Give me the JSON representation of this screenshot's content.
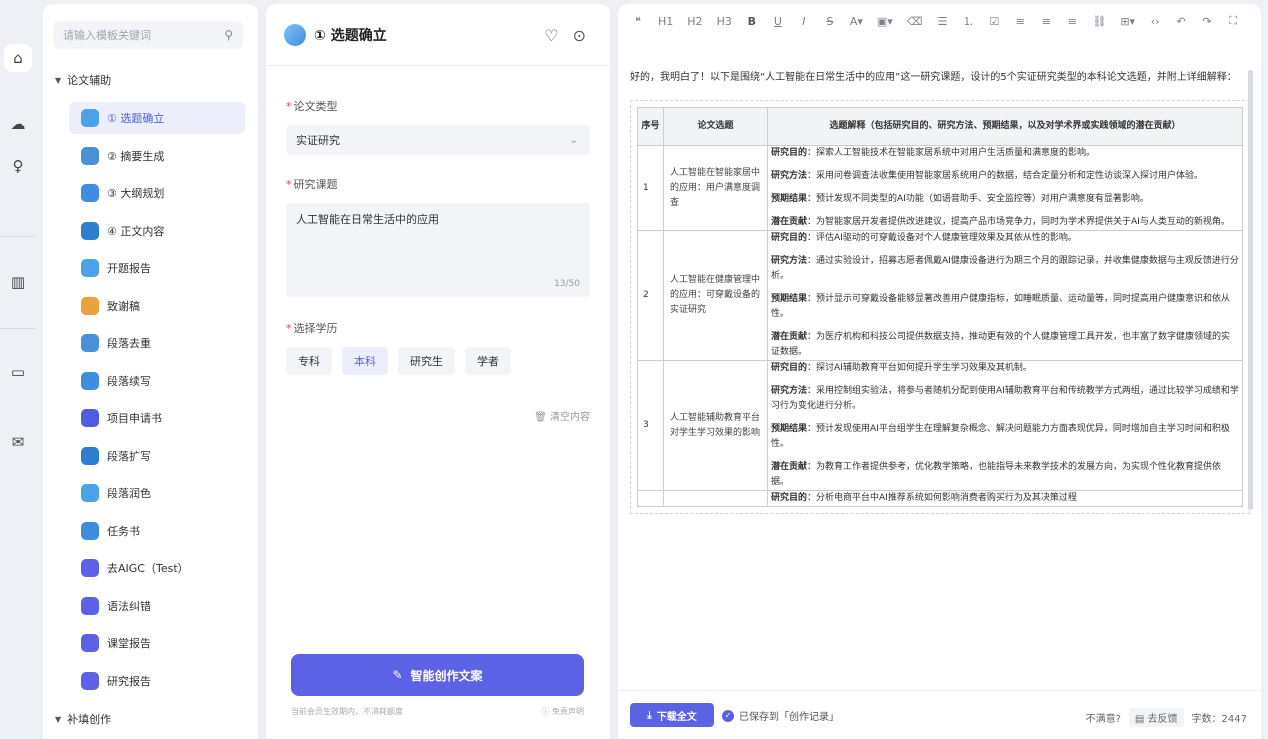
{
  "rail": {
    "items": [
      {
        "icon": "home-icon",
        "glyph": "⌂"
      },
      {
        "icon": "cloud-icon",
        "glyph": "☁"
      },
      {
        "icon": "lightbulb-icon",
        "glyph": "♀"
      },
      {
        "icon": "book-icon",
        "glyph": "▥"
      },
      {
        "icon": "chat-icon",
        "glyph": "▭"
      },
      {
        "icon": "mail-icon",
        "glyph": "✉"
      }
    ]
  },
  "sidebar": {
    "search_placeholder": "请输入模板关键词",
    "group1": "论文辅助",
    "group2": "补填创作",
    "items": [
      {
        "label": "① 选题确立",
        "color": "#4aa3e8"
      },
      {
        "label": "② 摘要生成",
        "color": "#4a90d9"
      },
      {
        "label": "③ 大纲规划",
        "color": "#3d8de0"
      },
      {
        "label": "④ 正文内容",
        "color": "#2d7dd2"
      },
      {
        "label": "开题报告",
        "color": "#4aa3e8"
      },
      {
        "label": "致谢稿",
        "color": "#e8a33d"
      },
      {
        "label": "段落去重",
        "color": "#4a90d9"
      },
      {
        "label": "段落续写",
        "color": "#3d8de0"
      },
      {
        "label": "项目申请书",
        "color": "#4f5de0"
      },
      {
        "label": "段落扩写",
        "color": "#2d7dd2"
      },
      {
        "label": "段落润色",
        "color": "#4aa3e8"
      },
      {
        "label": "任务书",
        "color": "#3d8de0"
      },
      {
        "label": "去AIGC（Test）",
        "color": "#5b62e6"
      },
      {
        "label": "语法纠错",
        "color": "#5b62e6"
      },
      {
        "label": "课堂报告",
        "color": "#5b62e6"
      },
      {
        "label": "研究报告",
        "color": "#5b62e6"
      }
    ]
  },
  "form": {
    "title": "① 选题确立",
    "type_label": "论文类型",
    "type_value": "实证研究",
    "topic_label": "研究课题",
    "topic_value": "人工智能在日常生活中的应用",
    "topic_count": "13/50",
    "degree_label": "选择学历",
    "degrees": [
      "专科",
      "本科",
      "研究生",
      "学者"
    ],
    "selected_degree": "本科",
    "clear_label": "清空内容",
    "generate_label": "智能创作文案",
    "foot_left": "当前会员生效期内，不消耗额度",
    "foot_right": "免责声明"
  },
  "editor": {
    "toolbar": [
      "❝",
      "H1",
      "H2",
      "H3",
      "B",
      "U",
      "I",
      "S",
      "A▾",
      "▣▾",
      "⌫",
      "☰",
      "⒈",
      "☑",
      "≡",
      "≡",
      "≡",
      "⛓",
      "⊞▾",
      "‹›",
      "↶",
      "↷",
      "⛶"
    ],
    "intro": "好的，我明白了！以下是围绕“人工智能在日常生活中的应用”这一研究课题，设计的5个实证研究类型的本科论文选题，并附上详细解释：",
    "headers": [
      "序号",
      "论文选题",
      "选题解释（包括研究目的、研究方法、预期结果，以及对学术界或实践领域的潜在贡献）"
    ],
    "rows": [
      {
        "no": "1",
        "title": "人工智能在智能家居中的应用：用户满意度调查",
        "parts": [
          {
            "k": "研究目的",
            "v": "：探索人工智能技术在智能家居系统中对用户生活质量和满意度的影响。"
          },
          {
            "k": "研究方法",
            "v": "：采用问卷调查法收集使用智能家居系统用户的数据，结合定量分析和定性访谈深入探讨用户体验。"
          },
          {
            "k": "预期结果",
            "v": "：预计发现不同类型的AI功能（如语音助手、安全监控等）对用户满意度有显著影响。"
          },
          {
            "k": "潜在贡献",
            "v": "：为智能家居开发者提供改进建议，提高产品市场竞争力，同时为学术界提供关于AI与人类互动的新视角。"
          }
        ]
      },
      {
        "no": "2",
        "title": "人工智能在健康管理中的应用：可穿戴设备的实证研究",
        "parts": [
          {
            "k": "研究目的",
            "v": "：评估AI驱动的可穿戴设备对个人健康管理效果及其依从性的影响。"
          },
          {
            "k": "研究方法",
            "v": "：通过实验设计，招募志愿者佩戴AI健康设备进行为期三个月的跟踪记录，并收集健康数据与主观反馈进行分析。"
          },
          {
            "k": "预期结果",
            "v": "：预计显示可穿戴设备能够显著改善用户健康指标，如睡眠质量、运动量等，同时提高用户健康意识和依从性。"
          },
          {
            "k": "潜在贡献",
            "v": "：为医疗机构和科技公司提供数据支持，推动更有效的个人健康管理工具开发，也丰富了数字健康领域的实证数据。"
          }
        ]
      },
      {
        "no": "3",
        "title": "人工智能辅助教育平台对学生学习效果的影响",
        "parts": [
          {
            "k": "研究目的",
            "v": "：探讨AI辅助教育平台如何提升学生学习效果及其机制。"
          },
          {
            "k": "研究方法",
            "v": "：采用控制组实验法，将参与者随机分配到使用AI辅助教育平台和传统教学方式两组，通过比较学习成绩和学习行为变化进行分析。"
          },
          {
            "k": "预期结果",
            "v": "：预计发现使用AI平台组学生在理解复杂概念、解决问题能力方面表现优异，同时增加自主学习时间和积极性。"
          },
          {
            "k": "潜在贡献",
            "v": "：为教育工作者提供参考，优化教学策略，也能指导未来教学技术的发展方向，为实现个性化教育提供依据。"
          }
        ]
      },
      {
        "no": "",
        "title": "",
        "parts": [
          {
            "k": "研究目的",
            "v": "：分析电商平台中AI推荐系统如何影响消费者购买行为及其决策过程"
          }
        ]
      }
    ],
    "download_label": "下载全文",
    "saved_label": "已保存到「创作记录」",
    "unsatisfied": "不满意?",
    "feedback": "去反馈",
    "word_count": "字数：2447"
  }
}
